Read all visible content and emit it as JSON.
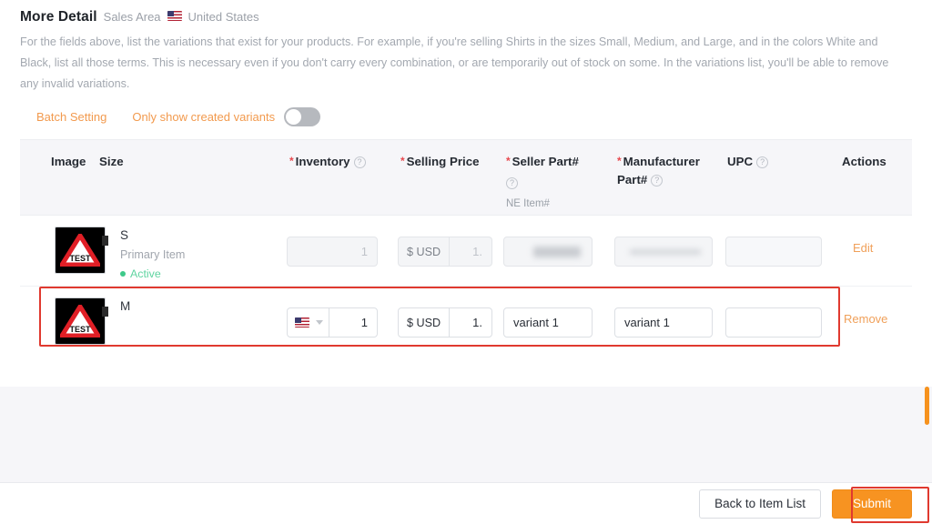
{
  "header": {
    "title": "More Detail",
    "subtitle": "Sales Area",
    "country": "United States",
    "flag_icon": "us-flag-icon"
  },
  "description": "For the fields above, list the variations that exist for your products. For example, if you're selling Shirts in the sizes Small, Medium, and Large, and in the colors White and Black, list all those terms. This is necessary even if you don't carry every combination, or are temporarily out of stock on some. In the variations list, you'll be able to remove any invalid variations.",
  "toolbar": {
    "batch_setting": "Batch Setting",
    "only_created_label": "Only show created variants",
    "toggle_state": "off"
  },
  "table": {
    "columns": {
      "image": "Image",
      "size": "Size",
      "inventory": "Inventory",
      "selling_price": "Selling Price",
      "seller_part": "Seller Part#",
      "seller_part_note": "NE Item#",
      "manufacturer_part": "Manufacturer Part#",
      "upc": "UPC",
      "actions": "Actions"
    },
    "rows": [
      {
        "image_alt": "TEST",
        "size": "S",
        "size_sub": "Primary Item",
        "status": "Active",
        "inventory": "1",
        "inventory_has_flag": false,
        "price_prefix": "$ USD",
        "price": "1.",
        "seller_part": "",
        "manufacturer_part": "",
        "upc": "",
        "action": "Edit",
        "disabled": true,
        "highlighted": false
      },
      {
        "image_alt": "TEST",
        "size": "M",
        "size_sub": "",
        "status": "",
        "inventory": "1",
        "inventory_has_flag": true,
        "price_prefix": "$ USD",
        "price": "1.",
        "seller_part": "variant 1",
        "manufacturer_part": "variant 1",
        "upc": "",
        "action": "Remove",
        "disabled": false,
        "highlighted": true
      }
    ]
  },
  "footer": {
    "back_button": "Back to Item List",
    "submit_button": "Submit"
  },
  "colors": {
    "accent_orange": "#f79321",
    "link_orange": "#f29a4e",
    "highlight_red": "#e0392f",
    "required_red": "#e8494f",
    "active_green": "#3ec98a",
    "header_bg": "#f6f6f9"
  }
}
